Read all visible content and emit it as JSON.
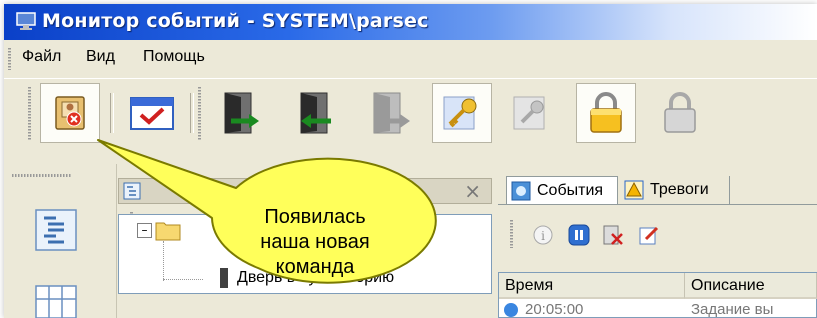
{
  "window": {
    "title": "Монитор событий - SYSTEM\\parsec"
  },
  "menu": {
    "items": [
      "Файл",
      "Вид",
      "Помощь"
    ]
  },
  "toolbar": {
    "buttons": [
      {
        "name": "event-card",
        "icon": "id-card-error-icon"
      },
      {
        "name": "calendar",
        "icon": "calendar-check-icon"
      },
      {
        "name": "door-enter",
        "icon": "door-arrow-right-icon"
      },
      {
        "name": "door-exit",
        "icon": "door-arrow-left-icon"
      },
      {
        "name": "door-both",
        "icon": "door-arrow-both-disabled-icon"
      },
      {
        "name": "key",
        "icon": "key-icon"
      },
      {
        "name": "key-disabled",
        "icon": "key-disabled-icon"
      },
      {
        "name": "lock",
        "icon": "padlock-icon"
      },
      {
        "name": "lock-disabled",
        "icon": "padlock-disabled-icon"
      }
    ]
  },
  "callout": {
    "text_line1": "Появилась",
    "text_line2": "наша новая",
    "text_line3": "команда"
  },
  "left_panel": {
    "close_symbol": "×",
    "tree": {
      "expand_symbol": "+",
      "collapse_symbol": "–",
      "child_label": "Дверь в бухгалтерию"
    }
  },
  "right_panel": {
    "tabs": [
      {
        "label": "События",
        "icon": "events-icon",
        "active": true
      },
      {
        "label": "Тревоги",
        "icon": "alarm-icon",
        "active": false
      }
    ],
    "columns": [
      "Время",
      "Описание"
    ],
    "rows": [
      {
        "time": "20:05:00",
        "description": "Задание вы"
      }
    ]
  },
  "colors": {
    "title_start": "#0a40c8",
    "window_bg": "#ece9d8",
    "callout_fill": "#ffff66",
    "callout_stroke": "#8a8a00"
  }
}
